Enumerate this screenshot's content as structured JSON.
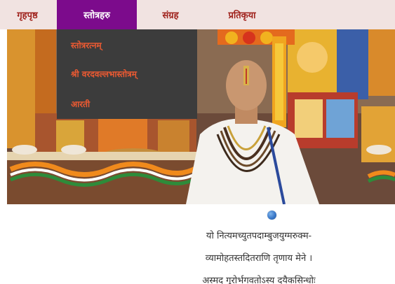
{
  "nav": {
    "items": [
      {
        "label": "गृहपृष्ठ"
      },
      {
        "label": "स्तोत्रहरु"
      },
      {
        "label": "संग्रह"
      },
      {
        "label": "प्रतिकृया"
      }
    ],
    "active_color": "#7c0b8c",
    "text_color": "#a0231d",
    "bar_color": "#f1e3e1"
  },
  "dropdown": {
    "items": [
      {
        "label": "स्तोत्ररत्नम्"
      },
      {
        "label": "श्री वरदवल्लभास्तोत्रम्"
      },
      {
        "label": "आरती"
      }
    ],
    "bg_color": "#3c3c3c",
    "text_color": "#ec5a32"
  },
  "slider": {
    "icon": "slider-dot-icon"
  },
  "verse": {
    "lines": [
      "यो नित्यमच्युतपदाम्बुजयुग्मरुक्म-",
      "व्यामोहतस्तदितराणि तृणाय मेने ।",
      "अस्मद् गुरोर्भगवतोऽस्य दयैकसिन्धोः"
    ]
  }
}
